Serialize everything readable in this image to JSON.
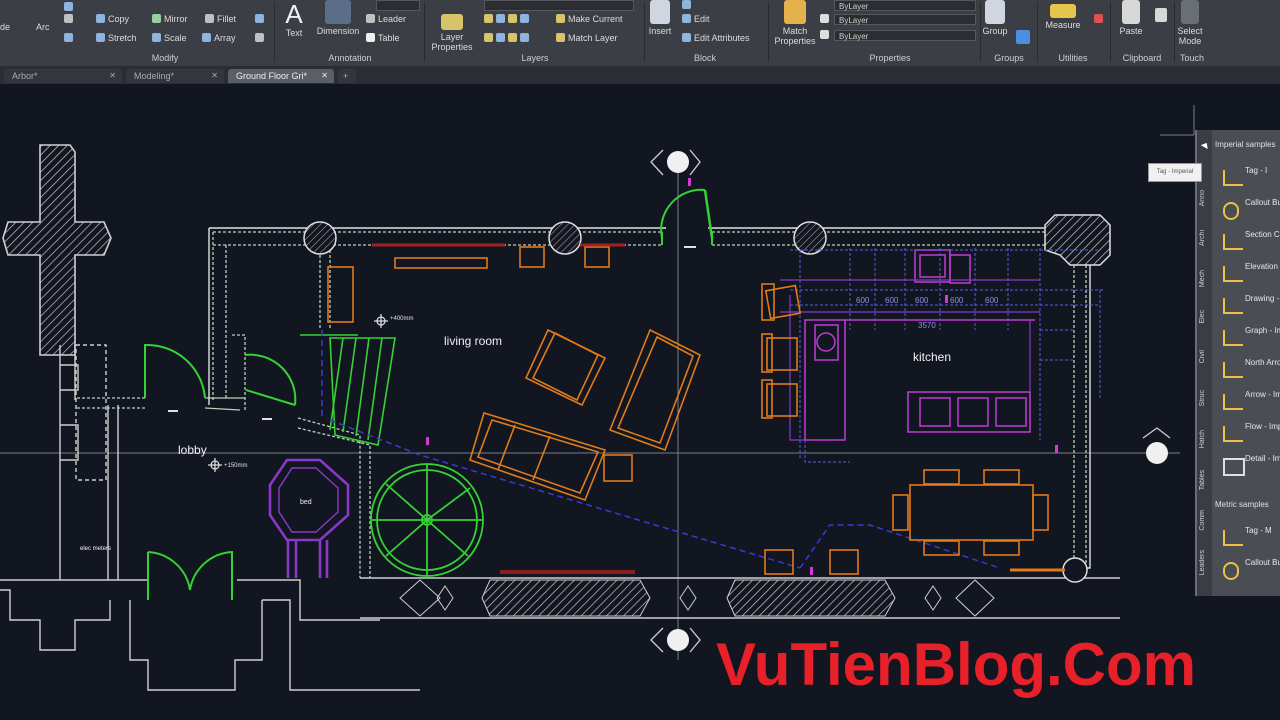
{
  "ribbon": {
    "modify_group": {
      "row1": [
        "Copy",
        "Mirror",
        "Fillet"
      ],
      "row2": [
        "Stretch",
        "Scale",
        "Array"
      ],
      "panel_label": "Modify"
    },
    "annotation_group": {
      "text_label": "Text",
      "dimension_label": "Dimension",
      "leader_label": "Leader",
      "table_label": "Table",
      "panel_label": "Annotation"
    },
    "layers_group": {
      "layer_properties_label": "Layer Properties",
      "make_current_label": "Make Current",
      "match_layer_label": "Match Layer",
      "panel_label": "Layers"
    },
    "block_group": {
      "insert_label": "Insert",
      "edit_label": "Edit",
      "edit_attributes_label": "Edit Attributes",
      "panel_label": "Block"
    },
    "properties_group": {
      "match_properties_label": "Match Properties",
      "bylayer_1": "ByLayer",
      "bylayer_2": "ByLayer",
      "bylayer_3": "ByLayer",
      "panel_label": "Properties"
    },
    "groups_group": {
      "group_label": "Group",
      "panel_label": "Groups"
    },
    "utilities_group": {
      "measure_label": "Measure",
      "panel_label": "Utilities"
    },
    "clipboard_group": {
      "paste_label": "Paste",
      "panel_label": "Clipboard"
    },
    "touch_group": {
      "select_mode_label": "Select Mode",
      "panel_label": "Touch"
    }
  },
  "tabs": [
    {
      "label": "Arbor*",
      "active": false
    },
    {
      "label": "Modeling*",
      "active": false
    },
    {
      "label": "Ground Floor Gri*",
      "active": true
    }
  ],
  "drawing": {
    "room_labels": {
      "living_room": "living room",
      "kitchen": "kitchen",
      "lobby": "lobby",
      "bed": "bed",
      "elec_meters": "elec meters"
    },
    "elevation_tags": {
      "living": "+400mm",
      "lobby": "+150mm"
    },
    "kitchen_dims": [
      "600",
      "600",
      "600",
      "600",
      "600",
      "3570"
    ]
  },
  "tool_palette": {
    "title": "Imperial samples",
    "items": [
      "Tag - I",
      "Callout Bubble",
      "Section Callout",
      "Elevation - Imperial",
      "Drawing - Imperial",
      "Graph - Imperial",
      "North Arrow - Imperial",
      "Arrow - Imperial",
      "Flow - Imperial",
      "Detail - Imperial"
    ],
    "metric_title": "Metric samples",
    "metric_items": [
      "Tag - M",
      "Callout Bubble"
    ],
    "tooltip": "Tag - Imperial"
  },
  "watermark": "VuTienBlog.Com",
  "colors": {
    "background": "#121620",
    "wall": "#9fc4a0",
    "green": "#35d135",
    "orange": "#e07b1c",
    "magenta": "#c23ad6",
    "purple": "#8a38c9",
    "blue": "#3a3ad1",
    "watermark": "#e8202a"
  }
}
